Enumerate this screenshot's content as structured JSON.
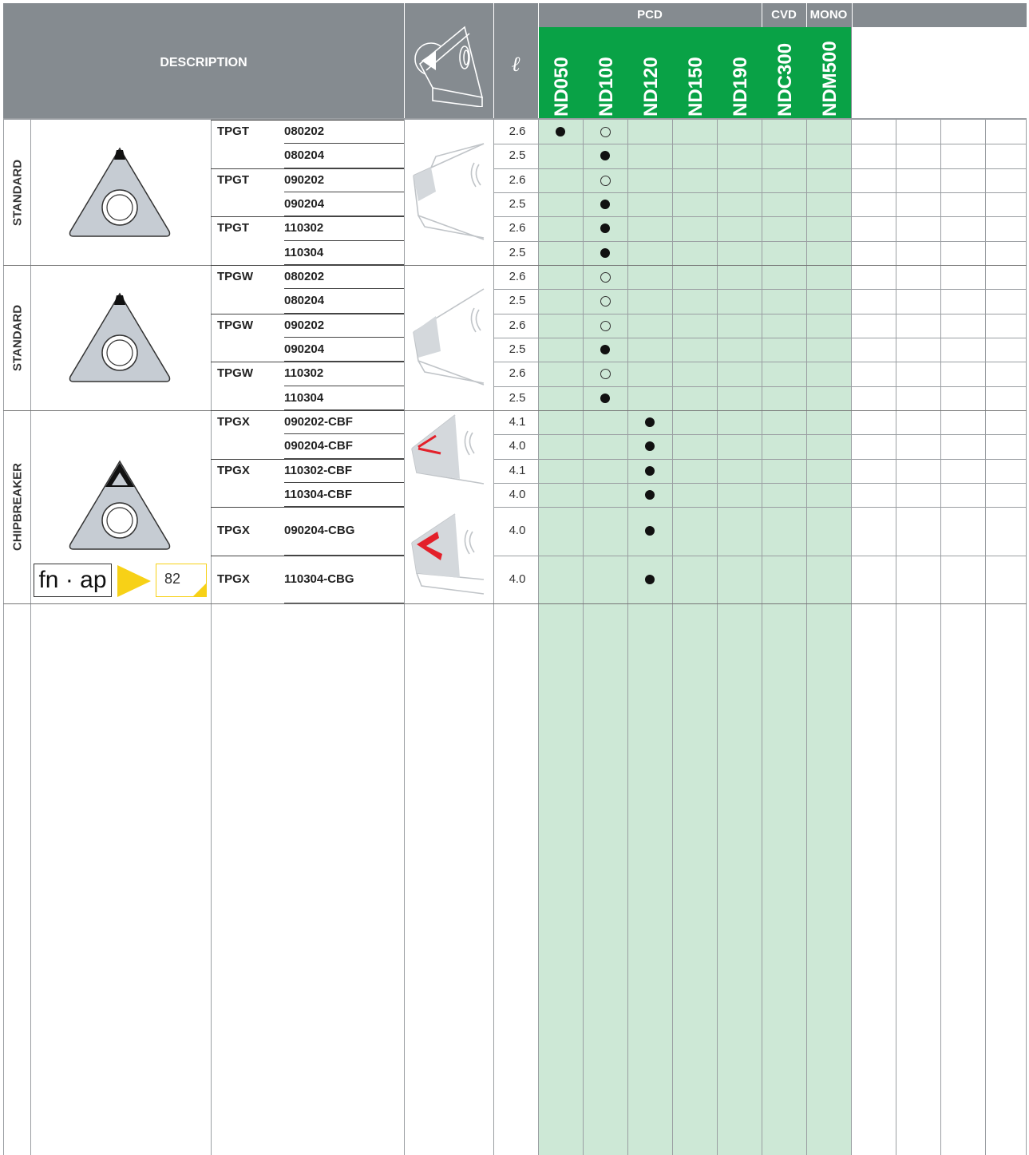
{
  "header": {
    "description_label": "DESCRIPTION",
    "length_symbol": "ℓ",
    "group_pcd": "PCD",
    "group_cvd": "CVD",
    "group_mono": "MONO",
    "grades": [
      "ND050",
      "ND100",
      "ND120",
      "ND150",
      "ND190",
      "NDC300",
      "NDM500"
    ]
  },
  "sections": [
    {
      "label": "STANDARD",
      "rows": [
        {
          "type": "TPGT",
          "size": "080202",
          "l": "2.6",
          "marks": {
            "ND050": "full",
            "ND100": "open"
          }
        },
        {
          "type": "",
          "size": "080204",
          "l": "2.5",
          "marks": {
            "ND100": "full"
          }
        },
        {
          "type": "TPGT",
          "size": "090202",
          "l": "2.6",
          "marks": {
            "ND100": "open"
          }
        },
        {
          "type": "",
          "size": "090204",
          "l": "2.5",
          "marks": {
            "ND100": "full"
          }
        },
        {
          "type": "TPGT",
          "size": "110302",
          "l": "2.6",
          "marks": {
            "ND100": "full"
          }
        },
        {
          "type": "",
          "size": "110304",
          "l": "2.5",
          "marks": {
            "ND100": "full"
          }
        }
      ]
    },
    {
      "label": "STANDARD",
      "rows": [
        {
          "type": "TPGW",
          "size": "080202",
          "l": "2.6",
          "marks": {
            "ND100": "open"
          }
        },
        {
          "type": "",
          "size": "080204",
          "l": "2.5",
          "marks": {
            "ND100": "open"
          }
        },
        {
          "type": "TPGW",
          "size": "090202",
          "l": "2.6",
          "marks": {
            "ND100": "open"
          }
        },
        {
          "type": "",
          "size": "090204",
          "l": "2.5",
          "marks": {
            "ND100": "full"
          }
        },
        {
          "type": "TPGW",
          "size": "110302",
          "l": "2.6",
          "marks": {
            "ND100": "open"
          }
        },
        {
          "type": "",
          "size": "110304",
          "l": "2.5",
          "marks": {
            "ND100": "full"
          }
        }
      ]
    },
    {
      "label": "CHIPBREAKER",
      "rows": [
        {
          "type": "TPGX",
          "size": "090202-CBF",
          "l": "4.1",
          "marks": {
            "ND120": "full"
          }
        },
        {
          "type": "",
          "size": "090204-CBF",
          "l": "4.0",
          "marks": {
            "ND120": "full"
          }
        },
        {
          "type": "TPGX",
          "size": "110302-CBF",
          "l": "4.1",
          "marks": {
            "ND120": "full"
          }
        },
        {
          "type": "",
          "size": "110304-CBF",
          "l": "4.0",
          "marks": {
            "ND120": "full"
          }
        },
        {
          "type": "TPGX",
          "size": "090204-CBG",
          "l": "4.0",
          "marks": {
            "ND120": "full"
          }
        },
        {
          "type": "TPGX",
          "size": "110304-CBG",
          "l": "4.0",
          "marks": {
            "ND120": "full"
          }
        }
      ]
    }
  ],
  "footer_badge": {
    "fn_ap_label": "fn · ap",
    "page_ref": "82"
  },
  "colors": {
    "header_gray": "#858b90",
    "grade_green": "#09a246",
    "light_green": "#cde8d6",
    "chipbreaker_red": "#e3202a",
    "badge_yellow": "#f7d117"
  }
}
